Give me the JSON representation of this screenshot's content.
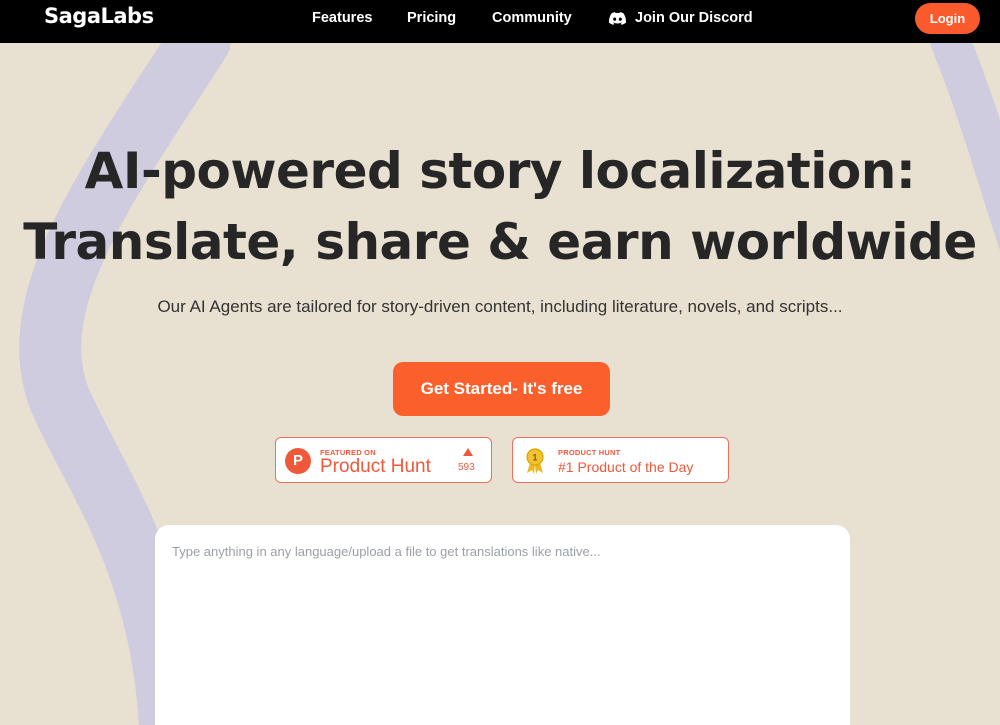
{
  "header": {
    "logo": "SagaLabs",
    "nav": [
      {
        "label": "Features"
      },
      {
        "label": "Pricing"
      },
      {
        "label": "Community"
      },
      {
        "label": "Join Our Discord",
        "icon": "discord-icon"
      }
    ],
    "login_label": "Login"
  },
  "hero": {
    "title_line1": "AI-powered story localization:",
    "title_line2": "Translate, share & earn worldwide",
    "subtitle": "Our AI Agents are tailored for story-driven content, including literature, novels, and scripts...",
    "cta_label": "Get Started- It's free"
  },
  "badges": {
    "product_hunt": {
      "small": "FEATURED ON",
      "big": "Product Hunt",
      "logo_letter": "P",
      "upvotes": "593"
    },
    "potd": {
      "small": "PRODUCT HUNT",
      "big": "#1 Product of the Day"
    }
  },
  "translator": {
    "placeholder": "Type anything in any language/upload a file to get translations like native..."
  },
  "colors": {
    "accent": "#fa5f2c",
    "background": "#e8e0d0",
    "deco_stroke": "#cfcce0",
    "nav_bg": "#000000"
  }
}
